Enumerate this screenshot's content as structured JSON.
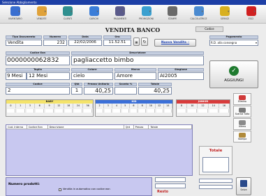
{
  "window": {
    "title": "Selezione Abbigliamento"
  },
  "toolbar": [
    {
      "label": "INVENTARIO",
      "color": "#3a6fd0"
    },
    {
      "label": "VENDITE",
      "color": "#e0a23a"
    },
    {
      "label": "CLIENTI",
      "color": "#2f8f8f"
    },
    {
      "label": "CARICHI",
      "color": "#3b7dd8"
    },
    {
      "label": "PAGAMENTI",
      "color": "#5a5a8a"
    },
    {
      "label": "PROMOZIONI",
      "color": "#3aa0d0"
    },
    {
      "label": "STAMPE",
      "color": "#6a6a6a"
    },
    {
      "label": "CALCOLATRICE",
      "color": "#4a8ad0"
    },
    {
      "label": "SERVIZI",
      "color": "#d8b020"
    },
    {
      "label": "ESCI",
      "color": "#d02020"
    }
  ],
  "page": {
    "title": "VENDITA BANCO",
    "codice_label": "Codice"
  },
  "doc": {
    "tipo_label": "Tipo Documento",
    "tipo": "Vendita",
    "numero_label": "Numero",
    "numero": "232",
    "data_label": "Data",
    "data": "22/02/2006",
    "ora_label": "Ora",
    "ora": "11.52.51",
    "nuova_vendita": "Nuova Vendita",
    "pagamento_label": "Pagamento",
    "pagamento": "R.D. alla consegna"
  },
  "item": {
    "codean_label": "Codice Ean",
    "codean": "0000000062832",
    "desc_label": "Descrizione",
    "desc": "pagliaccetto  bimbo",
    "taglia_label": "Taglia",
    "taglia1": "9 Mesi",
    "taglia2": "12 Mesi",
    "colore_label": "Colore",
    "colore": "cielo",
    "marca_label": "Marca",
    "marca": "Amore",
    "stagione_label": "Stagione",
    "stagione": "AI2005",
    "codice_label": "Codice",
    "codice": "2",
    "qta_label": "Qtà",
    "qta": "1",
    "prezzo_label": "Prezzo Unitario",
    "prezzo": "40,25",
    "sconto_label": "Sconto %",
    "sconto": "",
    "totale_label": "Totale",
    "totale": "40,25",
    "aggiungi": "AGGIUNGI"
  },
  "sizes": [
    {
      "title": "BABY",
      "color": "#f4e36a",
      "labels": [
        "0",
        "1",
        "3",
        "6",
        "9",
        "12",
        "18",
        "24",
        "36"
      ]
    },
    {
      "title": "KID",
      "color": "#3b6fd8",
      "labels": [
        "2",
        "3",
        "4",
        "5",
        "6",
        "8",
        "10",
        "12",
        "14"
      ]
    },
    {
      "title": "JUNIOR",
      "color": "#d83b3b",
      "labels": [
        "8",
        "10",
        "12",
        "14",
        "16"
      ]
    }
  ],
  "grid": {
    "headers": [
      "Cod. Interno",
      "Codice Ean",
      "Descrizione",
      "Qnt",
      "Prezzo",
      "Totale"
    ]
  },
  "side_buttons": [
    {
      "label": "Elimina",
      "color": "#d03a3a"
    },
    {
      "label": "Scarica Tutto",
      "color": "#7a7a7a"
    },
    {
      "label": "Ultimo",
      "color": "#8a8a8a"
    },
    {
      "label": "Stampa",
      "color": "#b08a3a"
    }
  ],
  "totals": {
    "label": "Totale",
    "value": ""
  },
  "bottom": {
    "numero_label": "Numero prodotti:",
    "auto_label": "Vendita in automatico con codice ean"
  },
  "resto": {
    "label": "Resto"
  },
  "save": {
    "label": "Salva"
  }
}
